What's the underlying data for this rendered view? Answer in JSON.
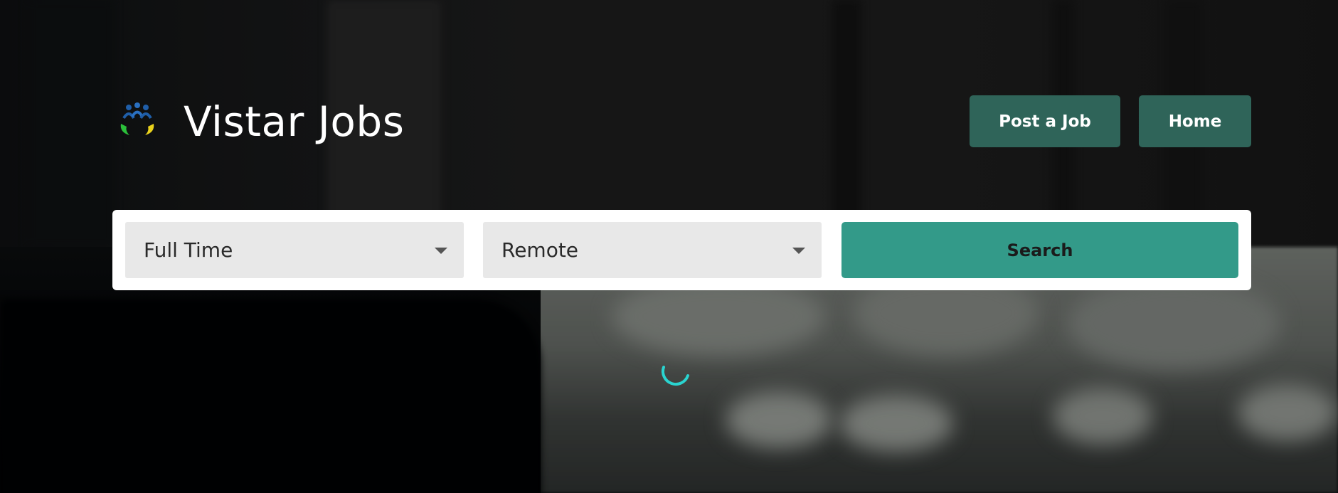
{
  "header": {
    "brand_title": "Vistar Jobs",
    "logo_icon": "people-hands-logo-icon",
    "nav": {
      "post_job_label": "Post a Job",
      "home_label": "Home"
    }
  },
  "search": {
    "job_type_value": "Full Time",
    "location_value": "Remote",
    "search_label": "Search"
  },
  "loading": {
    "icon": "loading-spinner-icon"
  },
  "colors": {
    "nav_button": "#2f6459",
    "search_button": "#339a89",
    "select_background": "#e8e8e8",
    "spinner": "#2ad4d0"
  }
}
